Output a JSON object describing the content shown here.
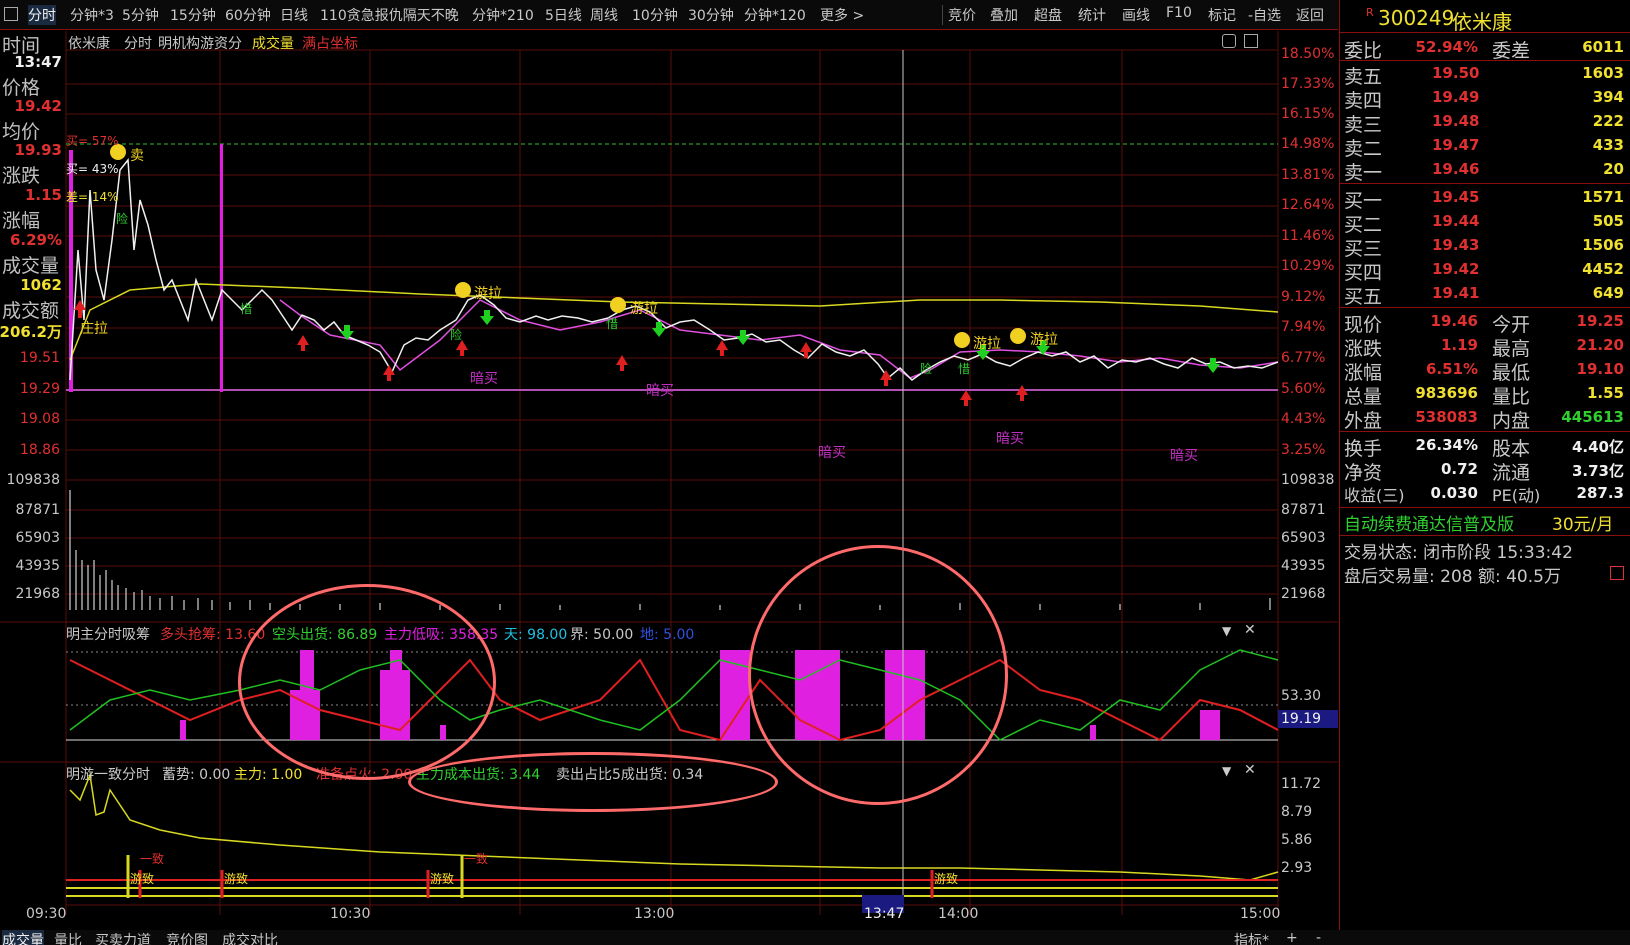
{
  "toolbar": {
    "periods": [
      "分时",
      "分钟*3",
      "5分钟",
      "15分钟",
      "60分钟",
      "日线",
      "110贪急报仇隔天不晚",
      "分钟*210",
      "5日线",
      "周线",
      "10分钟",
      "30分钟",
      "分钟*120",
      "更多 >"
    ],
    "active_period": "分时",
    "tools": [
      "竞价",
      "叠加",
      "超盘",
      "统计",
      "画线",
      "F10",
      "标记",
      "-自选",
      "返回"
    ]
  },
  "chart_header": {
    "name": "依米康",
    "mode": "分时",
    "indicator": "明机构游资分",
    "vol_label": "成交量",
    "coord": "满占坐标"
  },
  "left_panel": {
    "time_label": "时间",
    "time_value": "13:47",
    "price_label": "价格",
    "price_value": "19.42",
    "avg_label": "均价",
    "avg_value": "19.93",
    "change_label": "涨跌",
    "change_value": "1.15",
    "pct_label": "涨幅",
    "pct_value": "6.29%",
    "vol_label": "成交量",
    "vol_value": "1062",
    "amt_label": "成交额",
    "amt_value": "206.2万"
  },
  "price_ticks_left": [
    "19.51",
    "19.29",
    "19.08",
    "18.86"
  ],
  "pct_ticks_right": [
    "18.50%",
    "17.33%",
    "16.15%",
    "14.98%",
    "13.81%",
    "12.64%",
    "11.46%",
    "10.29%",
    "9.12%",
    "7.94%",
    "6.77%",
    "5.60%",
    "4.43%",
    "3.25%"
  ],
  "vol_ticks": [
    "109838",
    "87871",
    "65903",
    "43935",
    "21968"
  ],
  "ind1": {
    "name": "明主分时吸筹",
    "a": "多头抢筹: 13.60",
    "b": "空头出货: 86.89",
    "c": "主力低吸: 358.35",
    "d": "天: 98.00",
    "e": "界: 50.00",
    "f": "地: 5.00",
    "tick1": "53.30",
    "tick2": "19.19"
  },
  "ind2": {
    "name": "明游一致分时",
    "a": "蓄势: 0.00",
    "b": "主力: 1.00",
    "c": "准备点火: 2.00",
    "d": "主力成本出货: 3.44",
    "e": "卖出占比5成出货: 0.34",
    "ticks": [
      "11.72",
      "8.79",
      "5.86",
      "2.93"
    ]
  },
  "time_axis": [
    "09:30",
    "10:30",
    "13:00",
    "13:47",
    "14:00",
    "15:00"
  ],
  "chart_marks": {
    "youla": "游拉",
    "anmai": "暗买",
    "zhuangla": "庄拉",
    "youzhi": "游致",
    "yizhi": "一致",
    "xinglabel": "惜",
    "xian": "险",
    "mai": "卖"
  },
  "annotations": {
    "buy_pct": "买= 43%",
    "sell_pct": "买= 57%",
    "diff_pct": "差= 14%"
  },
  "right_panel": {
    "flag": "R",
    "code": "300249",
    "name": "依米康",
    "wb_label": "委比",
    "wb_value": "52.94%",
    "wc_label": "委差",
    "wc_value": "6011",
    "asks": [
      {
        "label": "卖五",
        "price": "19.50",
        "vol": "1603"
      },
      {
        "label": "卖四",
        "price": "19.49",
        "vol": "394"
      },
      {
        "label": "卖三",
        "price": "19.48",
        "vol": "222"
      },
      {
        "label": "卖二",
        "price": "19.47",
        "vol": "433"
      },
      {
        "label": "卖一",
        "price": "19.46",
        "vol": "20"
      }
    ],
    "bids": [
      {
        "label": "买一",
        "price": "19.45",
        "vol": "1571"
      },
      {
        "label": "买二",
        "price": "19.44",
        "vol": "505"
      },
      {
        "label": "买三",
        "price": "19.43",
        "vol": "1506"
      },
      {
        "label": "买四",
        "price": "19.42",
        "vol": "4452"
      },
      {
        "label": "买五",
        "price": "19.41",
        "vol": "649"
      }
    ],
    "stats": [
      {
        "a": "现价",
        "b": "19.46",
        "c": "今开",
        "d": "19.25"
      },
      {
        "a": "涨跌",
        "b": "1.19",
        "c": "最高",
        "d": "21.20"
      },
      {
        "a": "涨幅",
        "b": "6.51%",
        "c": "最低",
        "d": "19.10"
      },
      {
        "a": "总量",
        "b": "983696",
        "c": "量比",
        "d": "1.55"
      },
      {
        "a": "外盘",
        "b": "538083",
        "c": "内盘",
        "d": "445613"
      }
    ],
    "stats2": [
      {
        "a": "换手",
        "b": "26.34%",
        "c": "股本",
        "d": "4.40亿"
      },
      {
        "a": "净资",
        "b": "0.72",
        "c": "流通",
        "d": "3.73亿"
      },
      {
        "a": "收益(三)",
        "b": "0.030",
        "c": "PE(动)",
        "d": "287.3"
      }
    ],
    "ad": "自动续费通达信普及版",
    "ad_price": "30元/月",
    "trade_state": "交易状态: 闭市阶段 15:33:42",
    "after": "盘后交易量: 208  额: 40.5万"
  },
  "bottom_tabs": [
    "成交量",
    "量比",
    "买卖力道",
    "竞价图",
    "成交对比"
  ],
  "bottom_right": [
    "指标*",
    "+",
    "-"
  ]
}
